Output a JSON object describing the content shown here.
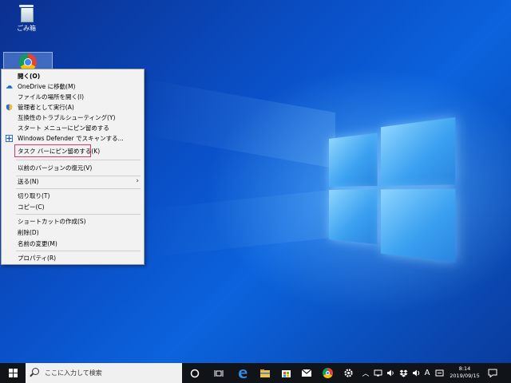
{
  "desktop": {
    "icons": [
      {
        "label": "ごみ箱"
      },
      {
        "label": "Google Chrome"
      }
    ]
  },
  "context_menu": {
    "items": [
      {
        "label": "開く(O)",
        "bold": true
      },
      {
        "label": "OneDrive に移動(M)",
        "icon": "onedrive-icon"
      },
      {
        "label": "ファイルの場所を開く(I)"
      },
      {
        "label": "管理者として実行(A)",
        "icon": "uac-shield-icon"
      },
      {
        "label": "互換性のトラブルシューティング(Y)"
      },
      {
        "label": "スタート メニューにピン留めする"
      },
      {
        "label": "Windows Defender でスキャンする...",
        "icon": "defender-icon"
      },
      {
        "label": "タスク バーにピン留めする(K)",
        "highlighted": true
      },
      {
        "label": "以前のバージョンの復元(V)"
      },
      {
        "label": "送る(N)",
        "submenu": true
      },
      {
        "label": "切り取り(T)"
      },
      {
        "label": "コピー(C)"
      },
      {
        "label": "ショートカットの作成(S)"
      },
      {
        "label": "削除(D)"
      },
      {
        "label": "名前の変更(M)"
      },
      {
        "label": "プロパティ(R)"
      }
    ],
    "highlight_color": "#e8336a"
  },
  "taskbar": {
    "search_placeholder": "ここに入力して検索",
    "apps": [
      "cortana-icon",
      "task-view-icon",
      "edge-icon",
      "file-explorer-icon",
      "store-icon",
      "mail-icon",
      "chrome-icon",
      "settings-icon"
    ],
    "tray": [
      "chevron-up-icon",
      "network-icon",
      "volume-icon",
      "dropbox-icon",
      "volume-icon",
      "ime-icon"
    ],
    "ime": "A",
    "time": "8:14",
    "date": "2019/09/15"
  }
}
